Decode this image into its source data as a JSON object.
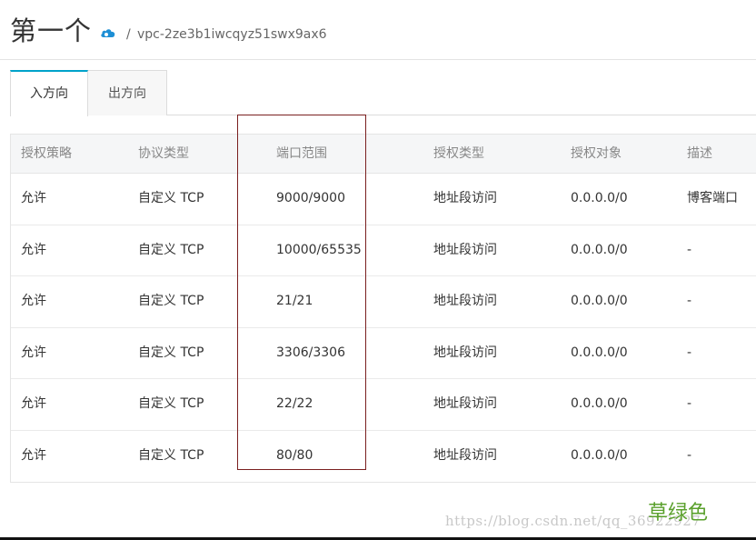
{
  "header": {
    "title": "第一个",
    "separator": "/",
    "vpc_id": "vpc-2ze3b1iwcqyz51swx9ax6"
  },
  "tabs": [
    {
      "label": "入方向",
      "active": true
    },
    {
      "label": "出方向",
      "active": false
    }
  ],
  "table": {
    "columns": [
      "授权策略",
      "协议类型",
      "端口范围",
      "授权类型",
      "授权对象",
      "描述"
    ],
    "rows": [
      [
        "允许",
        "自定义 TCP",
        "9000/9000",
        "地址段访问",
        "0.0.0.0/0",
        "博客端口"
      ],
      [
        "允许",
        "自定义 TCP",
        "10000/65535",
        "地址段访问",
        "0.0.0.0/0",
        "-"
      ],
      [
        "允许",
        "自定义 TCP",
        "21/21",
        "地址段访问",
        "0.0.0.0/0",
        "-"
      ],
      [
        "允许",
        "自定义 TCP",
        "3306/3306",
        "地址段访问",
        "0.0.0.0/0",
        "-"
      ],
      [
        "允许",
        "自定义 TCP",
        "22/22",
        "地址段访问",
        "0.0.0.0/0",
        "-"
      ],
      [
        "允许",
        "自定义 TCP",
        "80/80",
        "地址段访问",
        "0.0.0.0/0",
        "-"
      ]
    ]
  },
  "watermark": {
    "mark": "草绿色",
    "url": "https://blog.csdn.net/qq_36922927"
  },
  "colors": {
    "accent": "#00a2ca",
    "highlight_border": "#7a1f1f",
    "watermark_green": "#5aa02c"
  }
}
